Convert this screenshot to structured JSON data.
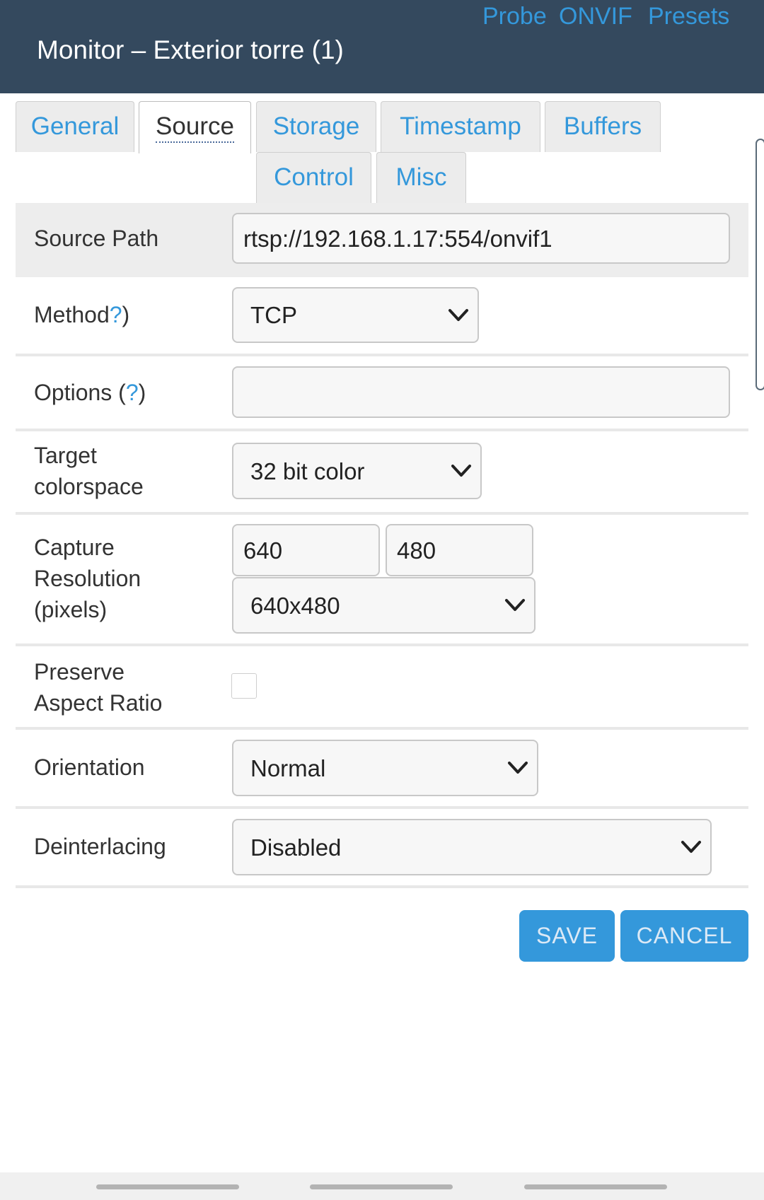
{
  "header": {
    "title": "Monitor – Exterior torre (1)",
    "links": {
      "probe": "Probe",
      "onvif": "ONVIF",
      "presets": "Presets"
    }
  },
  "tabs": [
    {
      "label": "General",
      "active": false
    },
    {
      "label": "Source",
      "active": true
    },
    {
      "label": "Storage",
      "active": false
    },
    {
      "label": "Timestamp",
      "active": false
    },
    {
      "label": "Buffers",
      "active": false
    },
    {
      "label": "Control",
      "active": false
    },
    {
      "label": "Misc",
      "active": false
    }
  ],
  "form": {
    "source_path": {
      "label": "Source Path",
      "value": "rtsp://192.168.1.17:554/onvif1"
    },
    "method": {
      "label": "Method",
      "help": "?",
      "suffix": ")",
      "value": "TCP"
    },
    "options": {
      "label": "Options (",
      "help": "?",
      "suffix": ")",
      "value": ""
    },
    "colorspace": {
      "label_line1": "Target",
      "label_line2": "colorspace",
      "value": "32 bit color"
    },
    "capture_resolution": {
      "label_line1": "Capture",
      "label_line2": "Resolution",
      "label_line3": "(pixels)",
      "width": "640",
      "height": "480",
      "preset": "640x480"
    },
    "preserve_aspect": {
      "label_line1": "Preserve",
      "label_line2": "Aspect Ratio",
      "checked": false
    },
    "orientation": {
      "label": "Orientation",
      "value": "Normal"
    },
    "deinterlacing": {
      "label": "Deinterlacing",
      "value": "Disabled"
    }
  },
  "buttons": {
    "save": "SAVE",
    "cancel": "CANCEL"
  },
  "colors": {
    "header_bg": "#34495e",
    "accent": "#3498db"
  },
  "icons": {
    "select_arrow": "chevron-down-icon",
    "nav_handle": "gesture-handle"
  }
}
